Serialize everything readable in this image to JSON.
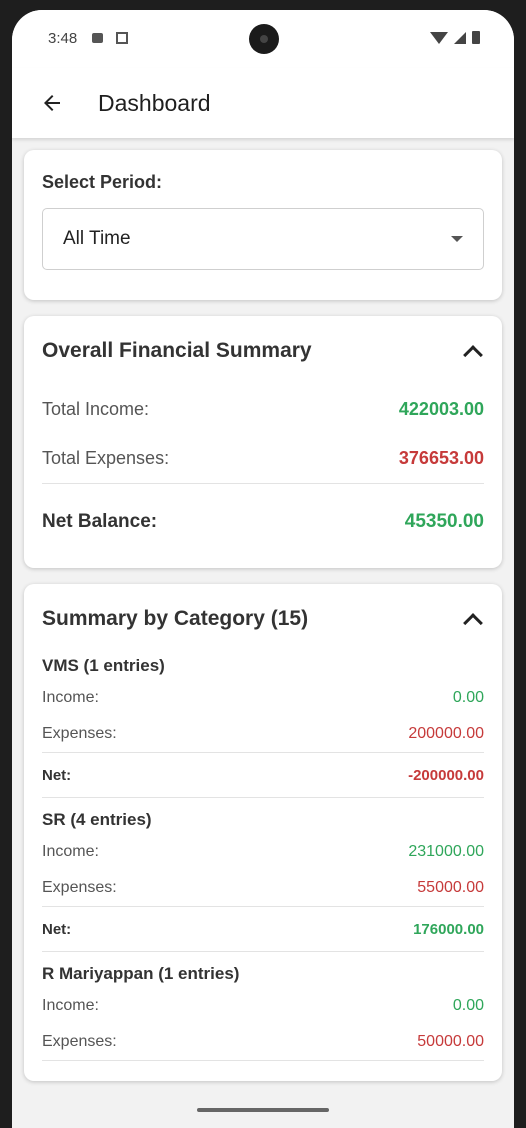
{
  "status_bar": {
    "time": "3:48"
  },
  "app_bar": {
    "title": "Dashboard"
  },
  "period": {
    "label": "Select Period:",
    "value": "All Time"
  },
  "overall": {
    "title": "Overall Financial Summary",
    "income_label": "Total Income:",
    "income_value": "422003.00",
    "expenses_label": "Total Expenses:",
    "expenses_value": "376653.00",
    "net_label": "Net Balance:",
    "net_value": "45350.00"
  },
  "category_summary": {
    "title": "Summary by Category (15)",
    "income_label": "Income:",
    "expenses_label": "Expenses:",
    "net_label": "Net:",
    "categories": [
      {
        "name": "VMS (1 entries)",
        "income": "0.00",
        "expenses": "200000.00",
        "net": "-200000.00"
      },
      {
        "name": "SR (4 entries)",
        "income": "231000.00",
        "expenses": "55000.00",
        "net": "176000.00"
      },
      {
        "name": "R Mariyappan (1 entries)",
        "income": "0.00",
        "expenses": "50000.00"
      }
    ]
  },
  "colors": {
    "income": "#2fa65a",
    "expense": "#c63a3a"
  }
}
